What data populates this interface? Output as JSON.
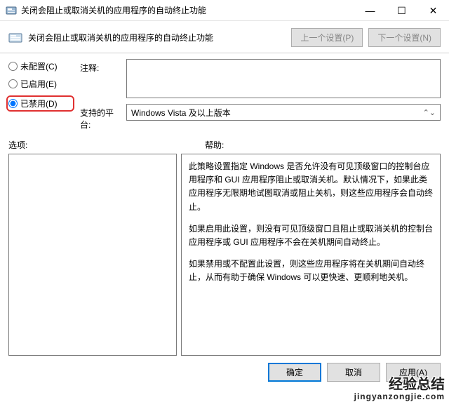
{
  "window": {
    "title": "关闭会阻止或取消关机的应用程序的自动终止功能",
    "minimize": "—",
    "maximize": "☐",
    "close": "✕"
  },
  "header": {
    "title": "关闭会阻止或取消关机的应用程序的自动终止功能",
    "prev": "上一个设置(P)",
    "next": "下一个设置(N)"
  },
  "radios": {
    "not_configured": "未配置(C)",
    "enabled": "已启用(E)",
    "disabled": "已禁用(D)"
  },
  "fields": {
    "comment_label": "注释:",
    "comment_value": "",
    "platform_label": "支持的平台:",
    "platform_value": "Windows Vista 及以上版本"
  },
  "sections": {
    "options": "选项:",
    "help": "帮助:"
  },
  "help_text": {
    "p1": "此策略设置指定 Windows 是否允许没有可见顶级窗口的控制台应用程序和 GUI 应用程序阻止或取消关机。默认情况下，如果此类应用程序无限期地试图取消或阻止关机，则这些应用程序会自动终止。",
    "p2": "如果启用此设置，则没有可见顶级窗口且阻止或取消关机的控制台应用程序或 GUI 应用程序不会在关机期间自动终止。",
    "p3": "如果禁用或不配置此设置，则这些应用程序将在关机期间自动终止，从而有助于确保 Windows 可以更快速、更顺利地关机。"
  },
  "footer": {
    "ok": "确定",
    "cancel": "取消",
    "apply": "应用(A)"
  },
  "watermark": {
    "main": "经验总结",
    "sub": "jingyanzongjie.com"
  }
}
